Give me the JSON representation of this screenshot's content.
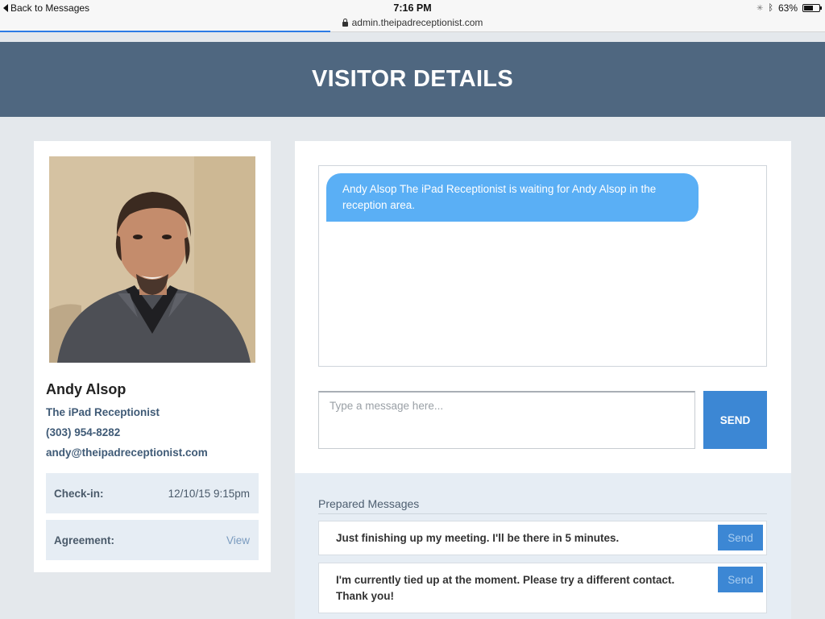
{
  "statusbar": {
    "back_label": "Back to Messages",
    "time": "7:16 PM",
    "battery_text": "63%",
    "battery_level": 0.63
  },
  "urlbar": {
    "url": "admin.theipadreceptionist.com",
    "load_progress": 0.4
  },
  "header": {
    "title": "VISITOR DETAILS"
  },
  "visitor": {
    "name": "Andy Alsop",
    "company": "The iPad Receptionist",
    "phone": "(303) 954-8282",
    "email": "andy@theipadreceptionist.com",
    "checkin_label": "Check-in:",
    "checkin_value": "12/10/15 9:15pm",
    "agreement_label": "Agreement:",
    "agreement_link": "View"
  },
  "chat": {
    "messages": [
      {
        "text": "Andy Alsop The iPad Receptionist is waiting for Andy Alsop in the reception area."
      }
    ],
    "input_placeholder": "Type a message here...",
    "send_label": "SEND"
  },
  "prepared": {
    "title": "Prepared Messages",
    "items": [
      {
        "text": "Just finishing up my meeting. I'll be there in 5 minutes.",
        "send_label": "Send"
      },
      {
        "text": "I'm currently tied up at the moment. Please try a different contact. Thank you!",
        "send_label": "Send"
      }
    ]
  },
  "colors": {
    "header_bg": "#4f6780",
    "bubble_bg": "#5aaff5",
    "button_bg": "#3c87d4",
    "link": "#3f5a76"
  },
  "icons": [
    "back-chevron-icon",
    "lock-icon",
    "bluetooth-icon",
    "activity-icon",
    "battery-icon"
  ]
}
